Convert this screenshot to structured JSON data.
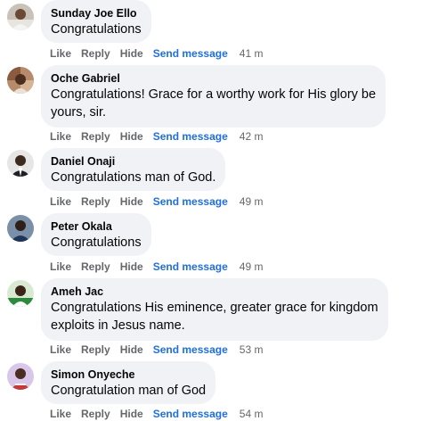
{
  "actions": {
    "like": "Like",
    "reply": "Reply",
    "hide": "Hide",
    "send": "Send message"
  },
  "comments": [
    {
      "author": "Sunday Joe Ello",
      "lines": [
        "Congratulations"
      ],
      "time": "41 m"
    },
    {
      "author": "Oche Gabriel",
      "lines": [
        "Congratulations! Grace for a worthy work for His glory be",
        "yours, sir."
      ],
      "time": "42 m"
    },
    {
      "author": "Daniel Onaji",
      "lines": [
        "Congratulations man of God."
      ],
      "time": "49 m"
    },
    {
      "author": "Peter Okala",
      "lines": [
        "Congratulations"
      ],
      "time": "49 m"
    },
    {
      "author": "Ameh Jac",
      "lines": [
        "Congratulations His eminence, greater grace for kingdom",
        "exploits in Jesus name."
      ],
      "time": "53 m"
    },
    {
      "author": "Simon Onyeche",
      "lines": [
        "Congratulation man of God"
      ],
      "time": "54 m"
    }
  ],
  "colors": {
    "bubble": "#f0f2f5",
    "action_text": "#65676b",
    "send_message": "#216fdb"
  }
}
